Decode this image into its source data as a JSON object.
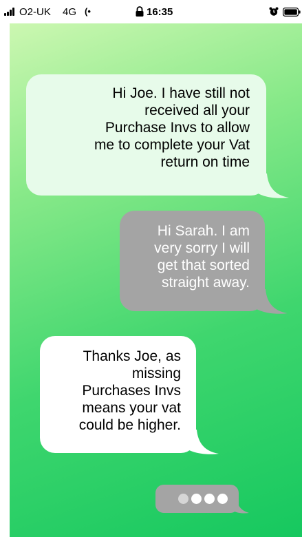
{
  "status_bar": {
    "carrier": "O2-UK",
    "network": "4G",
    "wifi_call_symbol": "(•",
    "time": "16:35",
    "signal_bars": 4,
    "icons": [
      "signal-bars-icon",
      "wifi-calling-icon",
      "lock-icon",
      "alarm-icon",
      "battery-icon"
    ]
  },
  "conversation": {
    "messages": [
      {
        "sender": "incoming",
        "lines": [
          "Hi Joe.  I have still not",
          "received all your",
          "Purchase Invs to allow",
          "me to complete your Vat",
          "return on time"
        ]
      },
      {
        "sender": "outgoing",
        "lines": [
          "Hi Sarah. I am",
          "very sorry I will",
          "get that sorted",
          "straight away."
        ]
      },
      {
        "sender": "incoming",
        "lines": [
          "Thanks Joe, as",
          "missing",
          "Purchases Invs",
          "means your vat",
          "could be higher."
        ]
      }
    ],
    "typing_indicator": {
      "dots": 4,
      "icon": "typing-dots-icon"
    }
  },
  "colors": {
    "gradient_start": "#ccf7b1",
    "gradient_end": "#16c85f",
    "bubble_light_green": "#e7fbea",
    "bubble_gray": "#a4a4a4",
    "bubble_white": "#ffffff"
  }
}
